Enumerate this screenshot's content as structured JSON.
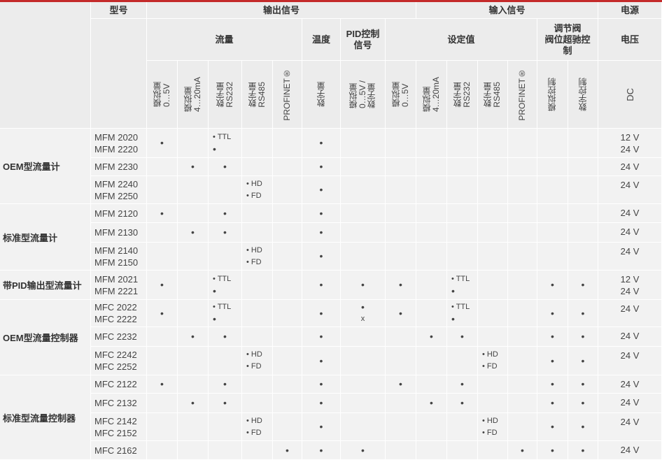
{
  "header": {
    "model": "型号",
    "output_signal": "输出信号",
    "input_signal": "输入信号",
    "power": "电源",
    "flow": "流量",
    "temp": "温度",
    "pid_output_signal": "PID控制\n信号",
    "setpoint": "设定值",
    "valve": "调节阀\n阀位超驰控\n制",
    "voltage": "电压",
    "cols": [
      "模拟量\n0…5V",
      "模拟量\n4…20mA",
      "数字量\nRS232",
      "数字量\nRS485",
      "PROFINET®",
      "数字量",
      "模拟量\n0…5V /\n数字量",
      "模拟量\n0…5V",
      "模拟量\n4…20mA",
      "数字量\nRS232",
      "数字量\nRS485",
      "PROFINET®",
      "模拟控制",
      "数字控制",
      "DC"
    ]
  },
  "groups": [
    {
      "name": "OEM型流量计"
    },
    {
      "name": "标准型流量计"
    },
    {
      "name": "带PID输出型流量计"
    },
    {
      "name": "OEM型流量控制器"
    },
    {
      "name": "标准型流量控制器"
    }
  ],
  "rows": [
    {
      "models": [
        "MFM 2020",
        "MFM 2220"
      ],
      "cells": {
        "c1": [
          "•"
        ],
        "c3": [
          "• TTL",
          "•"
        ],
        "c6": [
          "•"
        ]
      },
      "power": [
        "12 V",
        "24 V"
      ]
    },
    {
      "models": [
        "MFM 2230"
      ],
      "cells": {
        "c2": [
          "•"
        ],
        "c3": [
          "•"
        ],
        "c6": [
          "•"
        ]
      },
      "power": [
        "24 V"
      ]
    },
    {
      "models": [
        "MFM 2240",
        "MFM 2250"
      ],
      "cells": {
        "c4": [
          "• HD",
          "• FD"
        ],
        "c6": [
          "•"
        ]
      },
      "power": [
        "24 V"
      ]
    },
    {
      "models": [
        "MFM 2120"
      ],
      "cells": {
        "c1": [
          "•"
        ],
        "c3": [
          "•"
        ],
        "c6": [
          "•"
        ]
      },
      "power": [
        "24 V"
      ]
    },
    {
      "models": [
        "MFM 2130"
      ],
      "cells": {
        "c2": [
          "•"
        ],
        "c3": [
          "•"
        ],
        "c6": [
          "•"
        ]
      },
      "power": [
        "24 V"
      ]
    },
    {
      "models": [
        "MFM 2140",
        "MFM 2150"
      ],
      "cells": {
        "c4": [
          "• HD",
          "• FD"
        ],
        "c6": [
          "•"
        ]
      },
      "power": [
        "24 V"
      ]
    },
    {
      "models": [
        "MFM 2021",
        "MFM 2221"
      ],
      "cells": {
        "c1": [
          "•"
        ],
        "c3": [
          "• TTL",
          "•"
        ],
        "c6": [
          "•"
        ],
        "c7": [
          "•"
        ],
        "c8": [
          "•"
        ],
        "c10": [
          "• TTL",
          "•"
        ],
        "c13": [
          "•"
        ],
        "c14": [
          "•"
        ]
      },
      "power": [
        "12 V",
        "24 V"
      ]
    },
    {
      "models": [
        "MFC 2022",
        "MFC 2222"
      ],
      "cells": {
        "c1": [
          "•"
        ],
        "c3": [
          "• TTL",
          "•"
        ],
        "c6": [
          "•"
        ],
        "c7": [
          "•",
          "x"
        ],
        "c8": [
          "•"
        ],
        "c10": [
          "• TTL",
          "•"
        ],
        "c13": [
          "•"
        ],
        "c14": [
          "•"
        ]
      },
      "power": [
        "24 V"
      ]
    },
    {
      "models": [
        "MFC 2232"
      ],
      "cells": {
        "c2": [
          "•"
        ],
        "c3": [
          "•"
        ],
        "c6": [
          "•"
        ],
        "c9": [
          "•"
        ],
        "c10": [
          "•"
        ],
        "c13": [
          "•"
        ],
        "c14": [
          "•"
        ]
      },
      "power": [
        "24 V"
      ]
    },
    {
      "models": [
        "MFC 2242",
        "MFC 2252"
      ],
      "cells": {
        "c4": [
          "• HD",
          "• FD"
        ],
        "c6": [
          "•"
        ],
        "c11": [
          "• HD",
          "• FD"
        ],
        "c13": [
          "•"
        ],
        "c14": [
          "•"
        ]
      },
      "power": [
        "24 V"
      ]
    },
    {
      "models": [
        "MFC 2122"
      ],
      "cells": {
        "c1": [
          "•"
        ],
        "c3": [
          "•"
        ],
        "c6": [
          "•"
        ],
        "c8": [
          "•"
        ],
        "c10": [
          "•"
        ],
        "c13": [
          "•"
        ],
        "c14": [
          "•"
        ]
      },
      "power": [
        "24 V"
      ]
    },
    {
      "models": [
        "MFC 2132"
      ],
      "cells": {
        "c2": [
          "•"
        ],
        "c3": [
          "•"
        ],
        "c6": [
          "•"
        ],
        "c9": [
          "•"
        ],
        "c10": [
          "•"
        ],
        "c13": [
          "•"
        ],
        "c14": [
          "•"
        ]
      },
      "power": [
        "24 V"
      ]
    },
    {
      "models": [
        "MFC 2142",
        "MFC 2152"
      ],
      "cells": {
        "c4": [
          "• HD",
          "• FD"
        ],
        "c6": [
          "•"
        ],
        "c11": [
          "• HD",
          "• FD"
        ],
        "c13": [
          "•"
        ],
        "c14": [
          "•"
        ]
      },
      "power": [
        "24 V"
      ]
    },
    {
      "models": [
        "MFC 2162"
      ],
      "cells": {
        "c5": [
          "•"
        ],
        "c6": [
          "•"
        ],
        "c7": [
          "•"
        ],
        "c12": [
          "•"
        ],
        "c13": [
          "•"
        ],
        "c14": [
          "•"
        ]
      },
      "power": [
        "24 V"
      ]
    }
  ]
}
